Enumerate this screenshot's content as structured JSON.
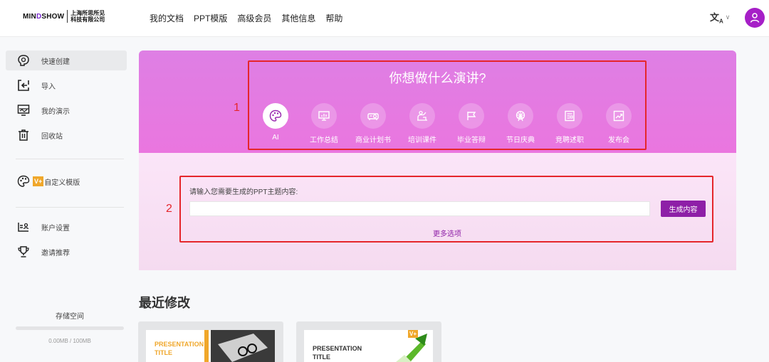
{
  "header": {
    "logo_word_a": "MIN",
    "logo_word_o": "D",
    "logo_word_b": "SHOW",
    "logo_cn_1": "上海所思所见",
    "logo_cn_2": "科技有限公司",
    "nav": [
      "我的文档",
      "PPT模版",
      "高级会员",
      "其他信息",
      "帮助"
    ],
    "lang_icon": "文A",
    "avatar_icon": "user-icon"
  },
  "sidebar": {
    "items": [
      {
        "label": "快速创建",
        "icon": "brain-icon",
        "active": true
      },
      {
        "label": "导入",
        "icon": "import-icon"
      },
      {
        "label": "我的演示",
        "icon": "presentation-icon"
      },
      {
        "label": "回收站",
        "icon": "trash-icon"
      }
    ],
    "custom_template": {
      "label": "自定义模版",
      "badge": "V+",
      "icon": "palette-icon"
    },
    "account_items": [
      {
        "label": "账户设置",
        "icon": "id-card-icon"
      },
      {
        "label": "邀请推荐",
        "icon": "trophy-icon"
      }
    ],
    "storage": {
      "title": "存储空间",
      "value": "0.00MB / 100MB",
      "used_fraction": 0.0
    }
  },
  "hero": {
    "title": "你想做什么演讲?",
    "categories": [
      {
        "label": "AI",
        "icon": "ai-palette-icon",
        "active": true
      },
      {
        "label": "工作总结",
        "icon": "monitor-chart-icon"
      },
      {
        "label": "商业计划书",
        "icon": "projector-icon"
      },
      {
        "label": "培训课件",
        "icon": "teacher-icon"
      },
      {
        "label": "毕业答辩",
        "icon": "grad-cap-icon"
      },
      {
        "label": "节日庆典",
        "icon": "ferris-wheel-icon"
      },
      {
        "label": "竞聘述职",
        "icon": "resume-icon"
      },
      {
        "label": "发布会",
        "icon": "trend-chart-icon"
      }
    ]
  },
  "generator": {
    "prompt_label": "请输入您需要生成的PPT主题内容:",
    "input_value": "",
    "input_placeholder": "",
    "button_label": "生成内容",
    "more_options": "更多选项"
  },
  "annotations": {
    "one": "1",
    "two": "2"
  },
  "recent": {
    "title": "最近修改",
    "cards": [
      {
        "title_line1": "PRESENTATION",
        "title_line2": "TITLE",
        "color": "#f0a72a"
      },
      {
        "title_line1": "PRESENTATION",
        "title_line2": "TITLE",
        "color": "#333333",
        "badge": "V+"
      }
    ]
  },
  "colors": {
    "accent": "#8e1fa7",
    "hero": "#e57fe2",
    "annotation": "#e5262b"
  }
}
